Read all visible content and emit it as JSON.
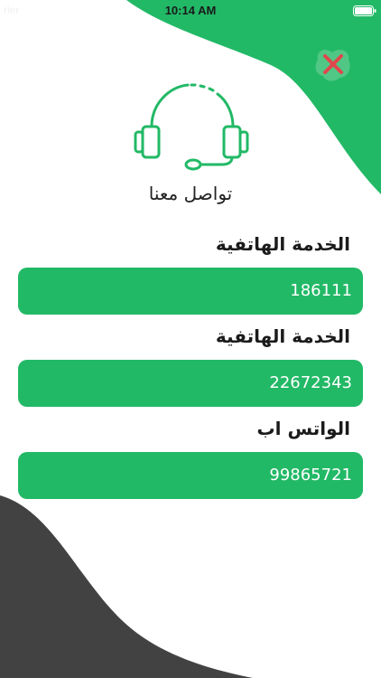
{
  "colors": {
    "accent": "#22b966",
    "dark_shape": "#424242",
    "close_x": "#e0474c"
  },
  "status_bar": {
    "carrier": "rier",
    "time": "10:14 AM"
  },
  "icons": {
    "wifi": "wifi-icon",
    "battery": "battery-icon",
    "close": "close-icon",
    "headset": "headset-icon"
  },
  "page": {
    "title": "تواصل معنا"
  },
  "contacts": [
    {
      "label": "الخدمة الهاتفية",
      "value": "186111"
    },
    {
      "label": "الخدمة الهاتفية",
      "value": "22672343"
    },
    {
      "label": "الواتس اب",
      "value": "99865721"
    }
  ]
}
